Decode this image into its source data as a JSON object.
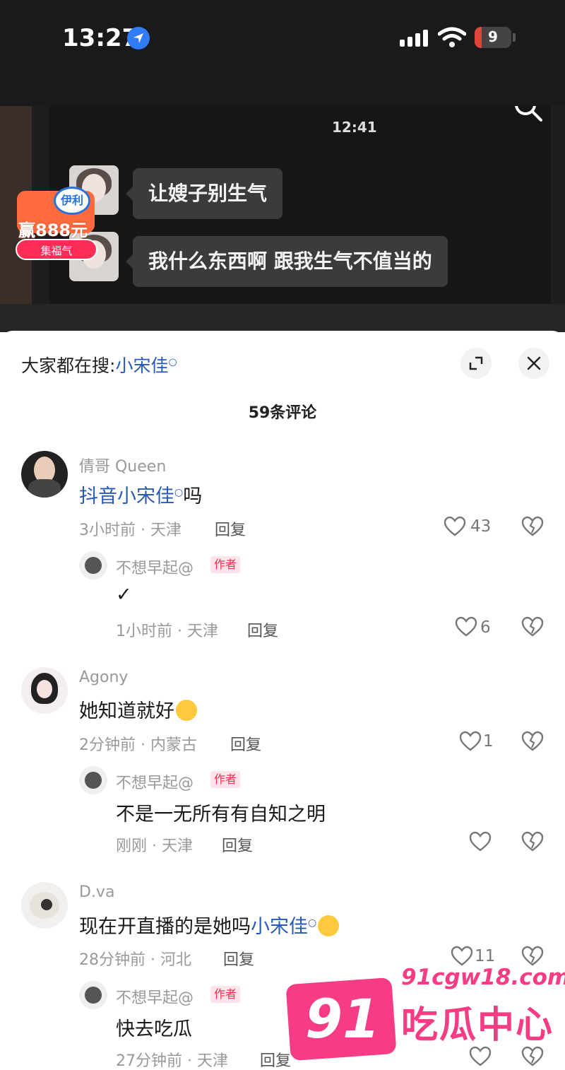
{
  "status_bar": {
    "time": "13:27",
    "battery": "9"
  },
  "video": {
    "timestamp": "12:41",
    "messages": [
      {
        "text": "让嫂子别生气"
      },
      {
        "text": "我什么东西啊 跟我生气不值当的"
      }
    ],
    "promo": {
      "brand": "伊利",
      "prize": "赢888元",
      "button": "集福气"
    }
  },
  "sheet": {
    "search_label": "大家都在搜:",
    "search_keyword": "小宋佳",
    "comment_count": "59条评论"
  },
  "comments": [
    {
      "username": "倩哥 Queen",
      "content_kw": "抖音小宋佳",
      "content_after": "吗",
      "meta": "3小时前 · 天津",
      "reply": "回复",
      "likes": "43",
      "sub": {
        "username": "不想早起@",
        "tag": "作者",
        "content": "✓",
        "meta": "1小时前 · 天津",
        "reply": "回复",
        "likes": "6"
      }
    },
    {
      "username": "Agony",
      "content": "她知道就好",
      "meta": "2分钟前 · 内蒙古",
      "reply": "回复",
      "likes": "1",
      "sub": {
        "username": "不想早起@",
        "tag": "作者",
        "content": "不是一无所有有自知之明",
        "meta": "刚刚 · 天津",
        "reply": "回复",
        "likes": ""
      }
    },
    {
      "username": "D.va",
      "content": "现在开直播的是她吗",
      "content_kw": "小宋佳",
      "meta": "28分钟前 · 河北",
      "reply": "回复",
      "likes": "11",
      "sub": {
        "username": "不想早起@",
        "tag": "作者",
        "content": "快去吃瓜",
        "meta": "27分钟前 · 天津",
        "reply": "回复",
        "likes": ""
      }
    }
  ],
  "watermark": {
    "number": "91",
    "url": "91cgw18.com",
    "name": "吃瓜中心"
  },
  "colors": {
    "accent_pink": "#f53c85",
    "keyword_blue": "#2a5ab8",
    "author_red": "#ff2d55"
  }
}
